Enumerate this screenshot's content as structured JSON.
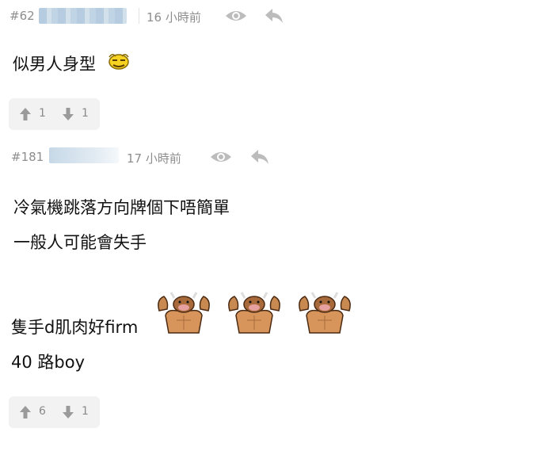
{
  "comments": [
    {
      "number": "#62",
      "time": "16 小時前",
      "lines": [
        "似男人身型"
      ],
      "upvotes": "1",
      "downvotes": "1",
      "emoji": [
        "sweating-face-emoji"
      ]
    },
    {
      "number": "#181",
      "time": "17 小時前",
      "lines": [
        "冷氣機跳落方向牌個下唔簡單",
        "一般人可能會失手",
        "隻手d肌肉好firm",
        "40 路boy"
      ],
      "upvotes": "6",
      "downvotes": "1",
      "emoji": [
        "muscle-bull-emoji",
        "muscle-bull-emoji",
        "muscle-bull-emoji"
      ]
    }
  ],
  "icons": {
    "view": "eye-icon",
    "reply": "reply-arrow-icon",
    "upvote": "thumb-arrow-up-icon",
    "downvote": "thumb-arrow-down-icon"
  },
  "colors": {
    "meta_text": "#8e8e8e",
    "vote_bg": "#f2f2f2",
    "text": "#111111"
  }
}
